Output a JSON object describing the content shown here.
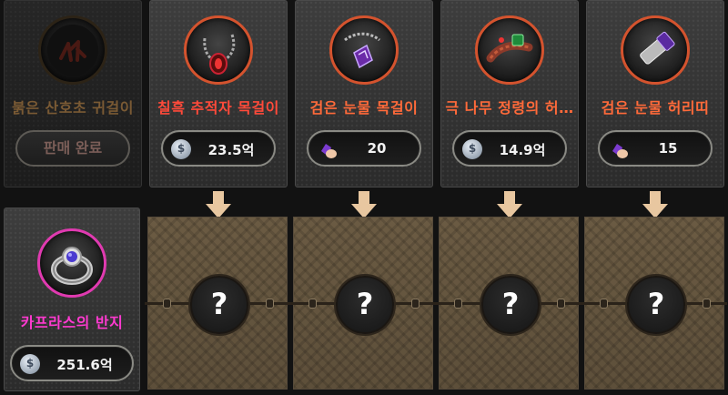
{
  "top_items": [
    {
      "name": "붉은 산호초 귀걸이",
      "status": "판매 완료",
      "icon": "red-coral-earring-icon",
      "name_color": "#7a5a34"
    },
    {
      "name": "칠흑 추적자 목걸이",
      "price": "23.5억",
      "currency": "silver-coin-icon",
      "icon": "pitch-black-tracker-necklace-icon",
      "name_color": "#ff4a3a"
    },
    {
      "name": "검은 눈물 목걸이",
      "price": "20",
      "currency": "purple-gem-icon",
      "icon": "black-tear-necklace-icon",
      "name_color": "#ff6a3a"
    },
    {
      "name": "극 나무 정령의 허…",
      "price": "14.9억",
      "currency": "silver-coin-icon",
      "icon": "tree-spirit-belt-icon",
      "name_color": "#ff6a3a"
    },
    {
      "name": "검은 눈물 허리띠",
      "price": "15",
      "currency": "purple-gem-icon",
      "icon": "black-tear-belt-icon",
      "name_color": "#ff6a3a"
    }
  ],
  "result_item": {
    "name": "카프라스의 반지",
    "price": "251.6억",
    "currency": "silver-coin-icon",
    "icon": "caphras-ring-icon",
    "name_color": "#ff3ad0"
  },
  "mystery_slots": [
    {
      "label": "?"
    },
    {
      "label": "?"
    },
    {
      "label": "?"
    },
    {
      "label": "?"
    }
  ],
  "coin_symbol": "$"
}
